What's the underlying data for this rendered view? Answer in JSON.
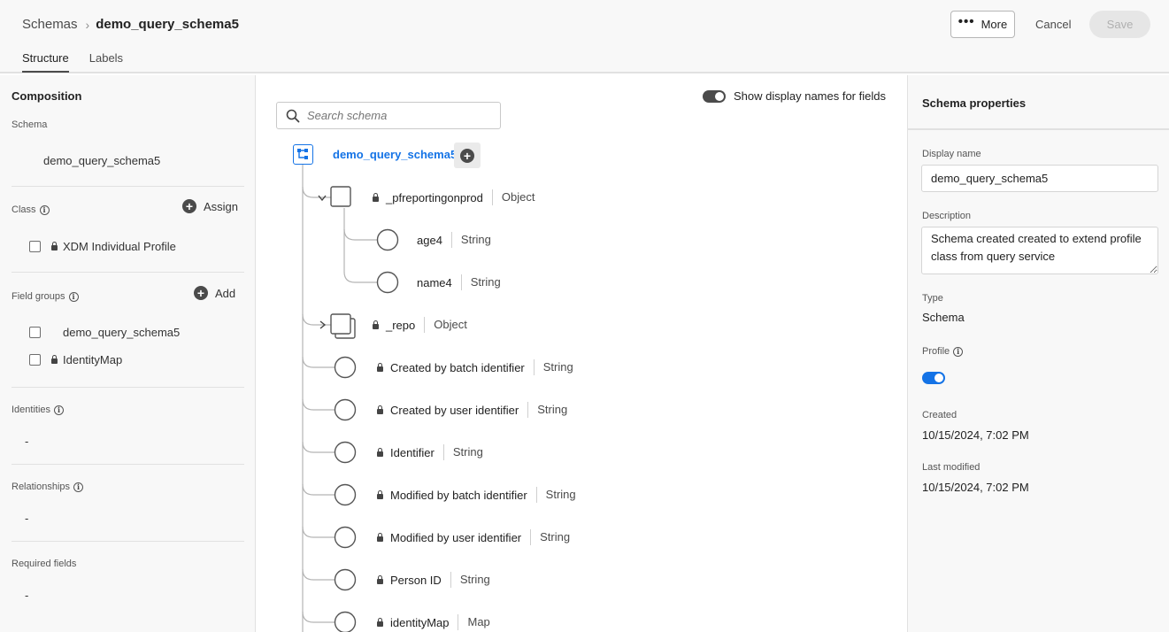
{
  "header": {
    "breadcrumb_root": "Schemas",
    "breadcrumb_separator": "›",
    "breadcrumb_current": "demo_query_schema5",
    "tabs": [
      {
        "label": "Structure",
        "active": true
      },
      {
        "label": "Labels",
        "active": false
      }
    ],
    "more_label": "More",
    "cancel_label": "Cancel",
    "save_label": "Save"
  },
  "composition": {
    "title": "Composition",
    "schema_label": "Schema",
    "schema_name": "demo_query_schema5",
    "class_label": "Class",
    "assign_label": "Assign",
    "class_item": "XDM Individual Profile",
    "field_groups_label": "Field groups",
    "add_label": "Add",
    "field_groups": [
      {
        "name": "demo_query_schema5",
        "locked": false
      },
      {
        "name": "IdentityMap",
        "locked": true
      }
    ],
    "identities_label": "Identities",
    "identities_value": "-",
    "relationships_label": "Relationships",
    "relationships_value": "-",
    "required_label": "Required fields",
    "required_value": "-"
  },
  "tree": {
    "search_placeholder": "Search schema",
    "toggle_label": "Show display names for fields",
    "toggle_on": true,
    "root": "demo_query_schema5",
    "nodes": [
      {
        "name": "_pfreportingonprod",
        "type": "Object",
        "locked": true
      },
      {
        "name": "age4",
        "type": "String",
        "locked": false
      },
      {
        "name": "name4",
        "type": "String",
        "locked": false
      },
      {
        "name": "_repo",
        "type": "Object",
        "locked": true
      },
      {
        "name": "Created by batch identifier",
        "type": "String",
        "locked": true
      },
      {
        "name": "Created by user identifier",
        "type": "String",
        "locked": true
      },
      {
        "name": "Identifier",
        "type": "String",
        "locked": true
      },
      {
        "name": "Modified by batch identifier",
        "type": "String",
        "locked": true
      },
      {
        "name": "Modified by user identifier",
        "type": "String",
        "locked": true
      },
      {
        "name": "Person ID",
        "type": "String",
        "locked": true
      },
      {
        "name": "identityMap",
        "type": "Map",
        "locked": true
      }
    ]
  },
  "properties": {
    "title": "Schema properties",
    "display_name_label": "Display name",
    "display_name_value": "demo_query_schema5",
    "description_label": "Description",
    "description_value": "Schema created created to extend profile class from query service",
    "type_label": "Type",
    "type_value": "Schema",
    "profile_label": "Profile",
    "profile_enabled": true,
    "created_label": "Created",
    "created_value": "10/15/2024, 7:02 PM",
    "modified_label": "Last modified",
    "modified_value": "10/15/2024, 7:02 PM"
  },
  "colors": {
    "accent": "#1473e6",
    "panel_bg": "#f8f8f8"
  }
}
